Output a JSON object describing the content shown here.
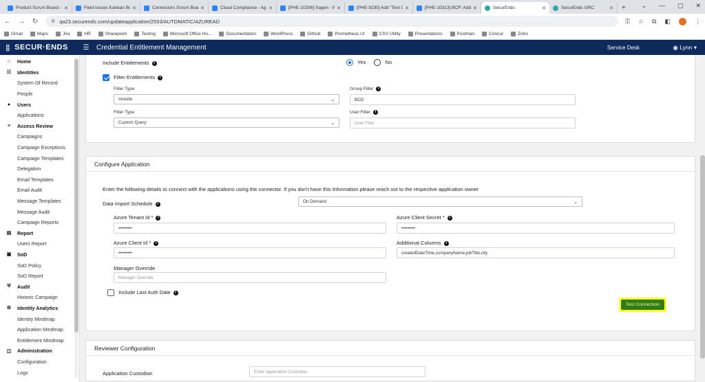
{
  "browser": {
    "tabs": [
      {
        "label": "Product Scrum Board -",
        "icon": "jira-icon"
      },
      {
        "label": "Field Issues Kanban Bo",
        "icon": "jira-icon"
      },
      {
        "label": "Connectors Scrum Boa",
        "icon": "jira-icon"
      },
      {
        "label": "Cloud Compliance - Ag",
        "icon": "jira-icon"
      },
      {
        "label": "[PHE-10206] Sagen - W",
        "icon": "jira-icon"
      },
      {
        "label": "[PHE-9230] Add \"Test C",
        "icon": "jira-icon"
      },
      {
        "label": "[PHE-10313] BCP: Add",
        "icon": "jira-icon"
      },
      {
        "label": "SecurEnds",
        "icon": "securends-icon",
        "active": true
      },
      {
        "label": "SecurEnds GRC",
        "icon": "securends-icon"
      }
    ],
    "url": "qa23.securends.com/updateapplication/2553/AUTOMATIC/AZUREAD",
    "bookmarks": [
      "Gmail",
      "Maps",
      "Jira",
      "HR",
      "Sharepoint",
      "Testing",
      "Microsoft Office Ho...",
      "Documentation",
      "WordPress",
      "Github",
      "Prometheus UI",
      "CSV Utility",
      "Presentations",
      "Postman",
      "Concur",
      "Zoho"
    ]
  },
  "header": {
    "logo": "SECUR·ENDS",
    "title": "Credential Entitlement Management",
    "service_desk": "Service Desk",
    "user": "Lynn"
  },
  "sidebar": {
    "items": [
      {
        "label": "Home",
        "section": true,
        "icon": "home-icon"
      },
      {
        "label": "Identities",
        "section": true,
        "icon": "users-icon"
      },
      {
        "label": "System Of Record"
      },
      {
        "label": "People"
      },
      {
        "label": "Users",
        "section": true,
        "icon": "user-icon"
      },
      {
        "label": "Applications"
      },
      {
        "label": "Access Review",
        "section": true,
        "icon": "list-icon"
      },
      {
        "label": "Campaigns"
      },
      {
        "label": "Campaign Exceptions"
      },
      {
        "label": "Campaign Templates"
      },
      {
        "label": "Delegation"
      },
      {
        "label": "Email Templates"
      },
      {
        "label": "Email Audit"
      },
      {
        "label": "Message Templates"
      },
      {
        "label": "Message Audit"
      },
      {
        "label": "Campaign Reports"
      },
      {
        "label": "Report",
        "section": true,
        "icon": "report-icon"
      },
      {
        "label": "Users Report"
      },
      {
        "label": "SoD",
        "section": true,
        "icon": "sod-icon"
      },
      {
        "label": "SoD Policy"
      },
      {
        "label": "SoD Report"
      },
      {
        "label": "Audit",
        "section": true,
        "icon": "shield-icon"
      },
      {
        "label": "Historic Campaign"
      },
      {
        "label": "Identity Analytics",
        "section": true,
        "icon": "analytics-icon"
      },
      {
        "label": "Identity Mindmap"
      },
      {
        "label": "Application Mindmap"
      },
      {
        "label": "Entitlement Mindmap"
      },
      {
        "label": "Administration",
        "section": true,
        "icon": "admin-icon"
      },
      {
        "label": "Configuration"
      },
      {
        "label": "Logs"
      }
    ]
  },
  "entitlements": {
    "include_label": "Include Entitlements",
    "yes": "Yes",
    "no": "No",
    "filter_label": "Filter Entitlements",
    "filter_type_label": "Filter Type",
    "filter_type_1": "Include",
    "group_filter_label": "Group Filter",
    "group_filter_value": "BCD",
    "filter_type_label_2": "Filter Type",
    "filter_type_2": "Custom Query",
    "user_filter_label": "User Filter",
    "user_filter_placeholder": "User Filter"
  },
  "configure": {
    "title": "Configure Application",
    "intro": "Enter the following details to connect with the applications using the connector. If you don't have this Information please reach out to the respective application owner",
    "schedule_label": "Data Import Schedule",
    "schedule_value": "On Demand",
    "tenant_label": "Azure Tenant Id *",
    "tenant_value": "•••••••••",
    "secret_label": "Azure Client Secret *",
    "secret_value": "•••••••••",
    "client_id_label": "Azure Client Id *",
    "client_id_value": "•••••••••",
    "columns_label": "Additional Columns",
    "columns_value": "createdDateTime,companyName,jobTitle,city",
    "manager_label": "Manager Override",
    "manager_placeholder": "Manager Override",
    "last_auth_label": "Include Last Auth Date",
    "test_button": "Test Connection"
  },
  "reviewer": {
    "title": "Reviewer Configuration",
    "custodian_label": "Application Custodian",
    "custodian_placeholder": "Enter Application Custodian"
  }
}
